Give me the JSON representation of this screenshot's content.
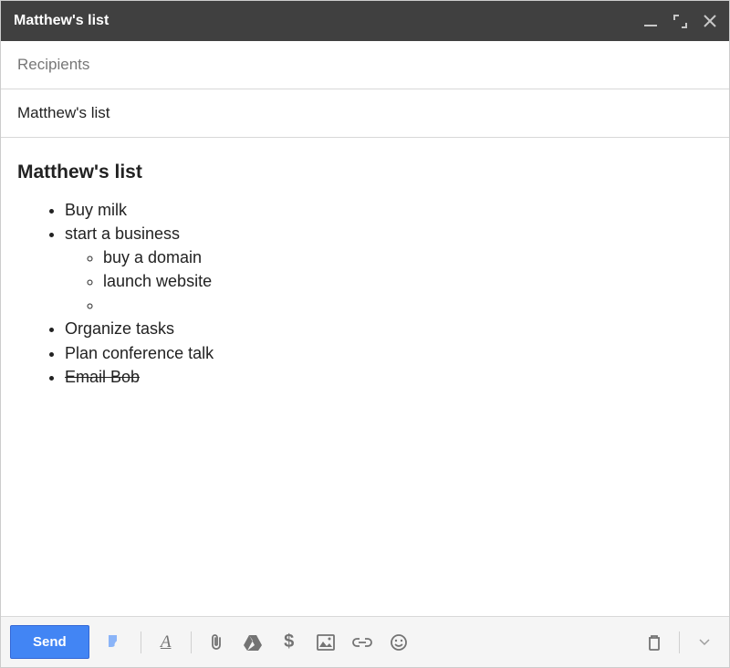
{
  "titlebar": {
    "title": "Matthew's list"
  },
  "recipients": {
    "placeholder": "Recipients",
    "value": ""
  },
  "subject": {
    "value": "Matthew's list"
  },
  "body": {
    "heading": "Matthew's list",
    "items": [
      {
        "text": "Buy milk",
        "strike": false
      },
      {
        "text": "start a business",
        "strike": false,
        "children": [
          {
            "text": "buy a domain"
          },
          {
            "text": "launch website"
          },
          {
            "text": ""
          }
        ]
      },
      {
        "text": "Organize tasks",
        "strike": false
      },
      {
        "text": "Plan conference talk",
        "strike": false
      },
      {
        "text": "Email Bob",
        "strike": true
      }
    ]
  },
  "toolbar": {
    "send_label": "Send"
  },
  "icons": {
    "attach": "📎",
    "dollar": "$",
    "emoji": "☺"
  }
}
